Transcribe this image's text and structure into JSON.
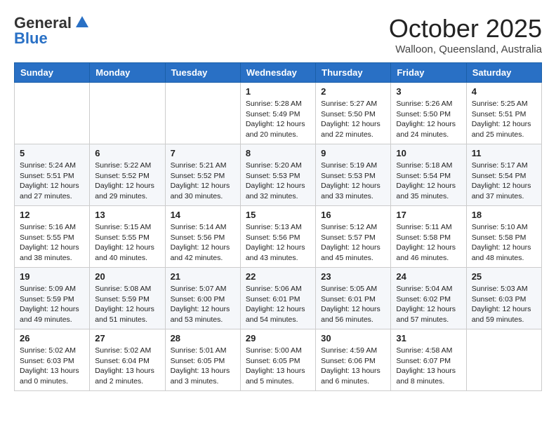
{
  "header": {
    "logo_general": "General",
    "logo_blue": "Blue",
    "month_title": "October 2025",
    "location": "Walloon, Queensland, Australia"
  },
  "weekdays": [
    "Sunday",
    "Monday",
    "Tuesday",
    "Wednesday",
    "Thursday",
    "Friday",
    "Saturday"
  ],
  "weeks": [
    [
      {
        "day": "",
        "info": ""
      },
      {
        "day": "",
        "info": ""
      },
      {
        "day": "",
        "info": ""
      },
      {
        "day": "1",
        "info": "Sunrise: 5:28 AM\nSunset: 5:49 PM\nDaylight: 12 hours\nand 20 minutes."
      },
      {
        "day": "2",
        "info": "Sunrise: 5:27 AM\nSunset: 5:50 PM\nDaylight: 12 hours\nand 22 minutes."
      },
      {
        "day": "3",
        "info": "Sunrise: 5:26 AM\nSunset: 5:50 PM\nDaylight: 12 hours\nand 24 minutes."
      },
      {
        "day": "4",
        "info": "Sunrise: 5:25 AM\nSunset: 5:51 PM\nDaylight: 12 hours\nand 25 minutes."
      }
    ],
    [
      {
        "day": "5",
        "info": "Sunrise: 5:24 AM\nSunset: 5:51 PM\nDaylight: 12 hours\nand 27 minutes."
      },
      {
        "day": "6",
        "info": "Sunrise: 5:22 AM\nSunset: 5:52 PM\nDaylight: 12 hours\nand 29 minutes."
      },
      {
        "day": "7",
        "info": "Sunrise: 5:21 AM\nSunset: 5:52 PM\nDaylight: 12 hours\nand 30 minutes."
      },
      {
        "day": "8",
        "info": "Sunrise: 5:20 AM\nSunset: 5:53 PM\nDaylight: 12 hours\nand 32 minutes."
      },
      {
        "day": "9",
        "info": "Sunrise: 5:19 AM\nSunset: 5:53 PM\nDaylight: 12 hours\nand 33 minutes."
      },
      {
        "day": "10",
        "info": "Sunrise: 5:18 AM\nSunset: 5:54 PM\nDaylight: 12 hours\nand 35 minutes."
      },
      {
        "day": "11",
        "info": "Sunrise: 5:17 AM\nSunset: 5:54 PM\nDaylight: 12 hours\nand 37 minutes."
      }
    ],
    [
      {
        "day": "12",
        "info": "Sunrise: 5:16 AM\nSunset: 5:55 PM\nDaylight: 12 hours\nand 38 minutes."
      },
      {
        "day": "13",
        "info": "Sunrise: 5:15 AM\nSunset: 5:55 PM\nDaylight: 12 hours\nand 40 minutes."
      },
      {
        "day": "14",
        "info": "Sunrise: 5:14 AM\nSunset: 5:56 PM\nDaylight: 12 hours\nand 42 minutes."
      },
      {
        "day": "15",
        "info": "Sunrise: 5:13 AM\nSunset: 5:56 PM\nDaylight: 12 hours\nand 43 minutes."
      },
      {
        "day": "16",
        "info": "Sunrise: 5:12 AM\nSunset: 5:57 PM\nDaylight: 12 hours\nand 45 minutes."
      },
      {
        "day": "17",
        "info": "Sunrise: 5:11 AM\nSunset: 5:58 PM\nDaylight: 12 hours\nand 46 minutes."
      },
      {
        "day": "18",
        "info": "Sunrise: 5:10 AM\nSunset: 5:58 PM\nDaylight: 12 hours\nand 48 minutes."
      }
    ],
    [
      {
        "day": "19",
        "info": "Sunrise: 5:09 AM\nSunset: 5:59 PM\nDaylight: 12 hours\nand 49 minutes."
      },
      {
        "day": "20",
        "info": "Sunrise: 5:08 AM\nSunset: 5:59 PM\nDaylight: 12 hours\nand 51 minutes."
      },
      {
        "day": "21",
        "info": "Sunrise: 5:07 AM\nSunset: 6:00 PM\nDaylight: 12 hours\nand 53 minutes."
      },
      {
        "day": "22",
        "info": "Sunrise: 5:06 AM\nSunset: 6:01 PM\nDaylight: 12 hours\nand 54 minutes."
      },
      {
        "day": "23",
        "info": "Sunrise: 5:05 AM\nSunset: 6:01 PM\nDaylight: 12 hours\nand 56 minutes."
      },
      {
        "day": "24",
        "info": "Sunrise: 5:04 AM\nSunset: 6:02 PM\nDaylight: 12 hours\nand 57 minutes."
      },
      {
        "day": "25",
        "info": "Sunrise: 5:03 AM\nSunset: 6:03 PM\nDaylight: 12 hours\nand 59 minutes."
      }
    ],
    [
      {
        "day": "26",
        "info": "Sunrise: 5:02 AM\nSunset: 6:03 PM\nDaylight: 13 hours\nand 0 minutes."
      },
      {
        "day": "27",
        "info": "Sunrise: 5:02 AM\nSunset: 6:04 PM\nDaylight: 13 hours\nand 2 minutes."
      },
      {
        "day": "28",
        "info": "Sunrise: 5:01 AM\nSunset: 6:05 PM\nDaylight: 13 hours\nand 3 minutes."
      },
      {
        "day": "29",
        "info": "Sunrise: 5:00 AM\nSunset: 6:05 PM\nDaylight: 13 hours\nand 5 minutes."
      },
      {
        "day": "30",
        "info": "Sunrise: 4:59 AM\nSunset: 6:06 PM\nDaylight: 13 hours\nand 6 minutes."
      },
      {
        "day": "31",
        "info": "Sunrise: 4:58 AM\nSunset: 6:07 PM\nDaylight: 13 hours\nand 8 minutes."
      },
      {
        "day": "",
        "info": ""
      }
    ]
  ]
}
